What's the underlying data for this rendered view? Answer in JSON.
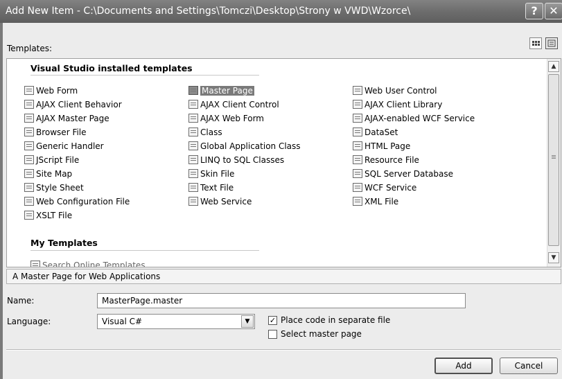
{
  "window": {
    "title": "Add New Item - C:\\Documents and Settings\\Tomczi\\Desktop\\Strony w VWD\\Wzorce\\",
    "help_label": "?",
    "close_label": "✕"
  },
  "templates_label": "Templates:",
  "groups": {
    "installed": "Visual Studio installed templates",
    "my": "My Templates"
  },
  "items": [
    {
      "label": "Web Form",
      "icon": "web-form-icon"
    },
    {
      "label": "AJAX Client Behavior",
      "icon": "ajax-client-behavior-icon"
    },
    {
      "label": "AJAX Master Page",
      "icon": "ajax-master-page-icon"
    },
    {
      "label": "Browser File",
      "icon": "browser-file-icon"
    },
    {
      "label": "Generic Handler",
      "icon": "generic-handler-icon"
    },
    {
      "label": "JScript File",
      "icon": "jscript-file-icon"
    },
    {
      "label": "Site Map",
      "icon": "site-map-icon"
    },
    {
      "label": "Style Sheet",
      "icon": "style-sheet-icon"
    },
    {
      "label": "Web Configuration File",
      "icon": "web-config-icon"
    },
    {
      "label": "XSLT File",
      "icon": "xslt-file-icon"
    },
    {
      "label": "Master Page",
      "icon": "master-page-icon",
      "selected": true
    },
    {
      "label": "AJAX Client Control",
      "icon": "ajax-client-control-icon"
    },
    {
      "label": "AJAX Web Form",
      "icon": "ajax-web-form-icon"
    },
    {
      "label": "Class",
      "icon": "class-icon"
    },
    {
      "label": "Global Application Class",
      "icon": "global-app-class-icon"
    },
    {
      "label": "LINQ to SQL Classes",
      "icon": "linq-to-sql-icon"
    },
    {
      "label": "Skin File",
      "icon": "skin-file-icon"
    },
    {
      "label": "Text File",
      "icon": "text-file-icon"
    },
    {
      "label": "Web Service",
      "icon": "web-service-icon"
    },
    {
      "label": "Web User Control",
      "icon": "web-user-control-icon"
    },
    {
      "label": "AJAX Client Library",
      "icon": "ajax-client-library-icon"
    },
    {
      "label": "AJAX-enabled WCF Service",
      "icon": "ajax-wcf-service-icon"
    },
    {
      "label": "DataSet",
      "icon": "dataset-icon"
    },
    {
      "label": "HTML Page",
      "icon": "html-page-icon"
    },
    {
      "label": "Resource File",
      "icon": "resource-file-icon"
    },
    {
      "label": "SQL Server Database",
      "icon": "sql-database-icon"
    },
    {
      "label": "WCF Service",
      "icon": "wcf-service-icon"
    },
    {
      "label": "XML File",
      "icon": "xml-file-icon"
    },
    {
      "label": "Search Online Templates...",
      "icon": "search-online-icon"
    }
  ],
  "description": "A Master Page for Web Applications",
  "form": {
    "name_label": "Name:",
    "name_value": "MasterPage.master",
    "language_label": "Language:",
    "language_value": "Visual C#",
    "place_code_label": "Place code in separate file",
    "place_code_checked": true,
    "select_master_label": "Select master page",
    "select_master_checked": false
  },
  "buttons": {
    "add": "Add",
    "cancel": "Cancel"
  }
}
